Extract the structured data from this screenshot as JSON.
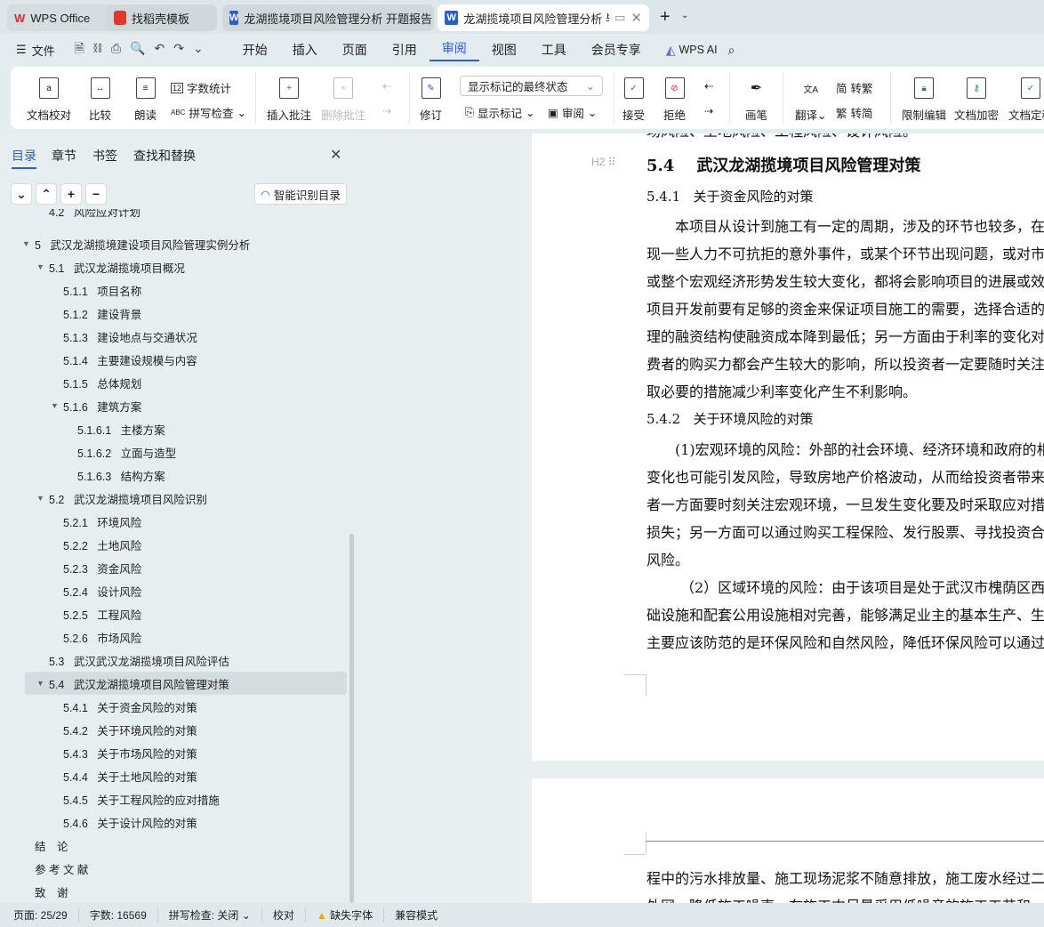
{
  "tabs": [
    {
      "label": "WPS Office",
      "icon": "wps-logo-icon"
    },
    {
      "label": "找稻壳模板",
      "icon": "docer-icon"
    },
    {
      "label": "龙湖揽境项目风险管理分析 开题报告",
      "icon": "word-doc-icon"
    },
    {
      "label": "龙湖揽境项目风险管理分析 毕",
      "icon": "word-doc-icon",
      "active": true
    }
  ],
  "menu": {
    "file": "文件",
    "items": [
      "开始",
      "插入",
      "页面",
      "引用",
      "审阅",
      "视图",
      "工具",
      "会员专享"
    ],
    "active": "审阅",
    "ai": "WPS AI"
  },
  "ribbon": {
    "doc_check": "文档校对",
    "compare": "比较",
    "read_aloud": "朗读",
    "word_count": "字数统计",
    "spell_check": "拼写检查",
    "insert_comment": "插入批注",
    "delete_comment": "删除批注",
    "track": "修订",
    "markup_state": "显示标记的最终状态",
    "show_markup": "显示标记",
    "review": "审阅",
    "accept": "接受",
    "reject": "拒绝",
    "pen": "画笔",
    "translate": "翻译",
    "to_trad": "转繁",
    "to_simp": "转简",
    "restrict": "限制编辑",
    "encrypt": "文档加密",
    "finalize": "文档定稿"
  },
  "sidebar": {
    "tabs": [
      "目录",
      "章节",
      "书签",
      "查找和替换"
    ],
    "smart_toc": "智能识别目录",
    "items": [
      {
        "num": "4.2",
        "text": "风险应对计划",
        "level": 1
      },
      {
        "num": "5",
        "text": "武汉龙湖揽境建设项目风险管理实例分析",
        "level": 0,
        "expanded": true
      },
      {
        "num": "5.1",
        "text": "武汉龙湖揽境项目概况",
        "level": 1,
        "expanded": true
      },
      {
        "num": "5.1.1",
        "text": "项目名称",
        "level": 2
      },
      {
        "num": "5.1.2",
        "text": "建设背景",
        "level": 2
      },
      {
        "num": "5.1.3",
        "text": "建设地点与交通状况",
        "level": 2
      },
      {
        "num": "5.1.4",
        "text": "主要建设规模与内容",
        "level": 2
      },
      {
        "num": "5.1.5",
        "text": "总体规划",
        "level": 2
      },
      {
        "num": "5.1.6",
        "text": "建筑方案",
        "level": 2,
        "expanded": true
      },
      {
        "num": "5.1.6.1",
        "text": "主楼方案",
        "level": 3
      },
      {
        "num": "5.1.6.2",
        "text": "立面与造型",
        "level": 3
      },
      {
        "num": "5.1.6.3",
        "text": "结构方案",
        "level": 3
      },
      {
        "num": "5.2",
        "text": "武汉龙湖揽境项目风险识别",
        "level": 1,
        "expanded": true
      },
      {
        "num": "5.2.1",
        "text": "环境风险",
        "level": 2
      },
      {
        "num": "5.2.2",
        "text": "土地风险",
        "level": 2
      },
      {
        "num": "5.2.3",
        "text": "资金风险",
        "level": 2
      },
      {
        "num": "5.2.4",
        "text": "设计风险",
        "level": 2
      },
      {
        "num": "5.2.5",
        "text": "工程风险",
        "level": 2
      },
      {
        "num": "5.2.6",
        "text": "市场风险",
        "level": 2
      },
      {
        "num": "5.3",
        "text": "武汉武汉龙湖揽境项目风险评估",
        "level": 1
      },
      {
        "num": "5.4",
        "text": "武汉龙湖揽境项目风险管理对策",
        "level": 1,
        "expanded": true,
        "selected": true
      },
      {
        "num": "5.4.1",
        "text": "关于资金风险的对策",
        "level": 2
      },
      {
        "num": "5.4.2",
        "text": "关于环境风险的对策",
        "level": 2
      },
      {
        "num": "5.4.3",
        "text": "关于市场风险的对策",
        "level": 2
      },
      {
        "num": "5.4.4",
        "text": "关于土地风险的对策",
        "level": 2
      },
      {
        "num": "5.4.5",
        "text": "关于工程风险的应对措施",
        "level": 2
      },
      {
        "num": "5.4.6",
        "text": "关于设计风险的对策",
        "level": 2
      },
      {
        "num": "",
        "text": "结　论",
        "level": 0
      },
      {
        "num": "",
        "text": "参 考 文 献",
        "level": 0
      },
      {
        "num": "",
        "text": "致　谢",
        "level": 0
      }
    ]
  },
  "document": {
    "clipped_top": "场风险、土地风险、工程风险、设计风险。",
    "heading_marker": "H2",
    "h2": {
      "num": "5.4",
      "text": "武汉龙湖揽境项目风险管理对策"
    },
    "h3a": {
      "num": "5.4.1",
      "text": "关于资金风险的对策"
    },
    "para1": [
      "本项目从设计到施工有一定的周期，涉及的环节也较多，在",
      "现一些人力不可抗拒的意外事件，或某个环节出现问题，或对市",
      "或整个宏观经济形势发生较大变化，都将会影响项目的进展或效",
      "项目开发前要有足够的资金来保证项目施工的需要，选择合适的",
      "理的融资结构使融资成本降到最低；另一方面由于利率的变化对",
      "费者的购买力都会产生较大的影响，所以投资者一定要随时关注",
      "取必要的措施减少利率变化产生不利影响。"
    ],
    "h3b": {
      "num": "5.4.2",
      "text": "关于环境风险的对策"
    },
    "para2": [
      "(1)宏观环境的风险：外部的社会环境、经济环境和政府的相",
      "变化也可能引发风险，导致房地产价格波动，从而给投资者带来",
      "者一方面要时刻关注宏观环境，一旦发生变化要及时采取应对措",
      "损失；另一方面可以通过购买工程保险、发行股票、寻找投资合",
      "风险。"
    ],
    "para3": [
      "（2）区域环境的风险：由于该项目是处于武汉市槐荫区西客",
      "础设施和配套公用设施相对完善，能够满足业主的基本生产、生",
      "主要应该防范的是环保风险和自然风险，降低环保风险可以通过"
    ],
    "page2": [
      "程中的污水排放量、施工现场泥浆不随意排放，施工废水经过二",
      "外网，降低施工噪声，在施工中尽量采用低噪音的施工工艺和"
    ]
  },
  "status": {
    "page": "页面: 25/29",
    "words": "字数: 16569",
    "spell": "拼写检查: 关闭",
    "proof": "校对",
    "missing_font": "缺失字体",
    "compat": "兼容模式"
  },
  "colors": {
    "accent": "#2d5bd8",
    "warning": "#f0a500"
  }
}
